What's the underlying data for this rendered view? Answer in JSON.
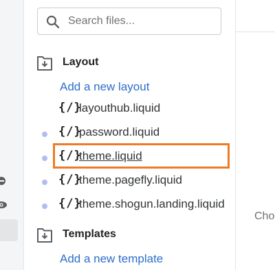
{
  "search": {
    "placeholder": "Search files...",
    "value": ""
  },
  "sections": {
    "layout": {
      "title": "Layout",
      "add_label": "Add a new layout",
      "files": [
        {
          "brace": "{/}",
          "name": "layouthub.liquid",
          "dot": false
        },
        {
          "brace": "{/}",
          "name": "password.liquid",
          "dot": true
        },
        {
          "brace": "{/}",
          "name": "theme.liquid",
          "dot": true,
          "active": true
        },
        {
          "brace": "{/}",
          "name": "theme.pagefly.liquid",
          "dot": true
        },
        {
          "brace": "{/}",
          "name": "theme.shogun.landing.liquid",
          "dot": true
        }
      ]
    },
    "templates": {
      "title": "Templates",
      "add_label": "Add a new template"
    }
  },
  "editor": {
    "hint": "Cho"
  },
  "colors": {
    "link": "#2c6ecb",
    "dot": "#b4bdf0",
    "highlight": "#ed7a26"
  },
  "icons": {
    "search": "search-icon",
    "folder": "folder-download-icon",
    "gutter": [
      "minus-circle-icon",
      "eye-icon"
    ]
  }
}
